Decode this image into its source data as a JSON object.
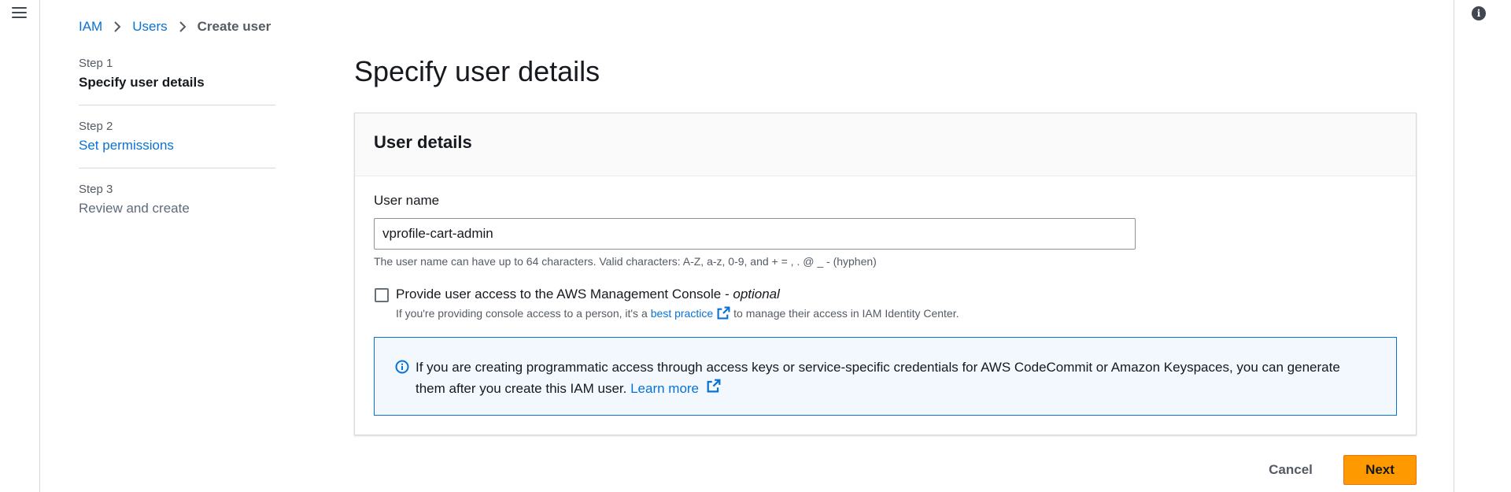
{
  "breadcrumb": {
    "items": [
      "IAM",
      "Users"
    ],
    "current": "Create user"
  },
  "steps": [
    {
      "num": "Step 1",
      "title": "Specify user details"
    },
    {
      "num": "Step 2",
      "title": "Set permissions"
    },
    {
      "num": "Step 3",
      "title": "Review and create"
    }
  ],
  "page_title": "Specify user details",
  "panel": {
    "title": "User details",
    "user_name_label": "User name",
    "user_name_value": "vprofile-cart-admin",
    "constraint": "The user name can have up to 64 characters. Valid characters: A-Z, a-z, 0-9, and + = , . @ _ - (hyphen)",
    "console_checkbox": {
      "label": "Provide user access to the AWS Management Console - ",
      "optional": "optional",
      "checked": false,
      "desc_before": "If you're providing console access to a person, it's a",
      "desc_link": "best practice",
      "desc_after": "to manage their access in IAM Identity Center."
    },
    "alert": {
      "text": "If you are creating programmatic access through access keys or service-specific credentials for AWS CodeCommit or Amazon Keyspaces, you can generate them after you create this IAM user.",
      "link": "Learn more"
    }
  },
  "buttons": {
    "cancel": "Cancel",
    "next": "Next"
  },
  "colors": {
    "link": "#0972d3",
    "primary": "#ff9900",
    "info_bg": "#f2f8fd"
  }
}
